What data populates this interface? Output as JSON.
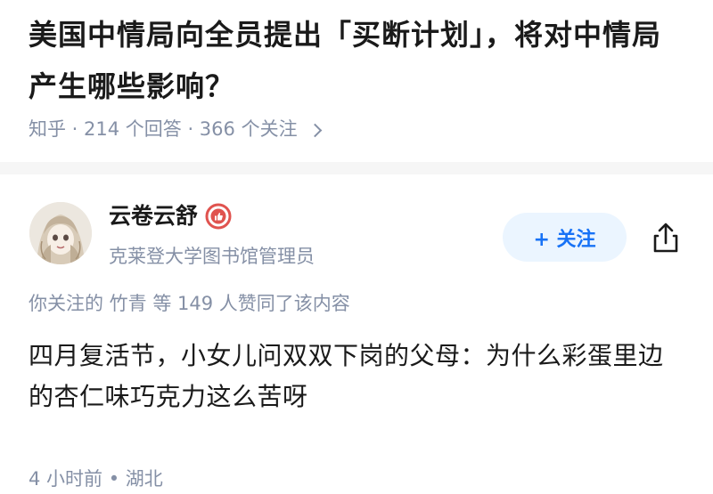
{
  "question": {
    "title": "美国中情局向全员提出「买断计划」，将对中情局产生哪些影响？",
    "meta": "知乎 · 214 个回答 · 366 个关注"
  },
  "answer": {
    "author_name": "云卷云舒",
    "author_bio": "克莱登大学图书馆管理员",
    "follow_label": "+ 关注",
    "likers_text": "你关注的 竹青 等 149 人赞同了该内容",
    "content": "四月复活节，小女儿问双双下岗的父母：为什么彩蛋里边的杏仁味巧克力这么苦呀",
    "footer": "4 小时前 • 湖北"
  },
  "colors": {
    "accent": "#1772f6",
    "follow_bg": "#ebf5ff",
    "meta_gray": "#8590a6",
    "badge_red": "#e0534f"
  },
  "icons": {
    "badge": "verified-badge-icon",
    "share": "share-icon",
    "chevron": "chevron-right-icon"
  }
}
